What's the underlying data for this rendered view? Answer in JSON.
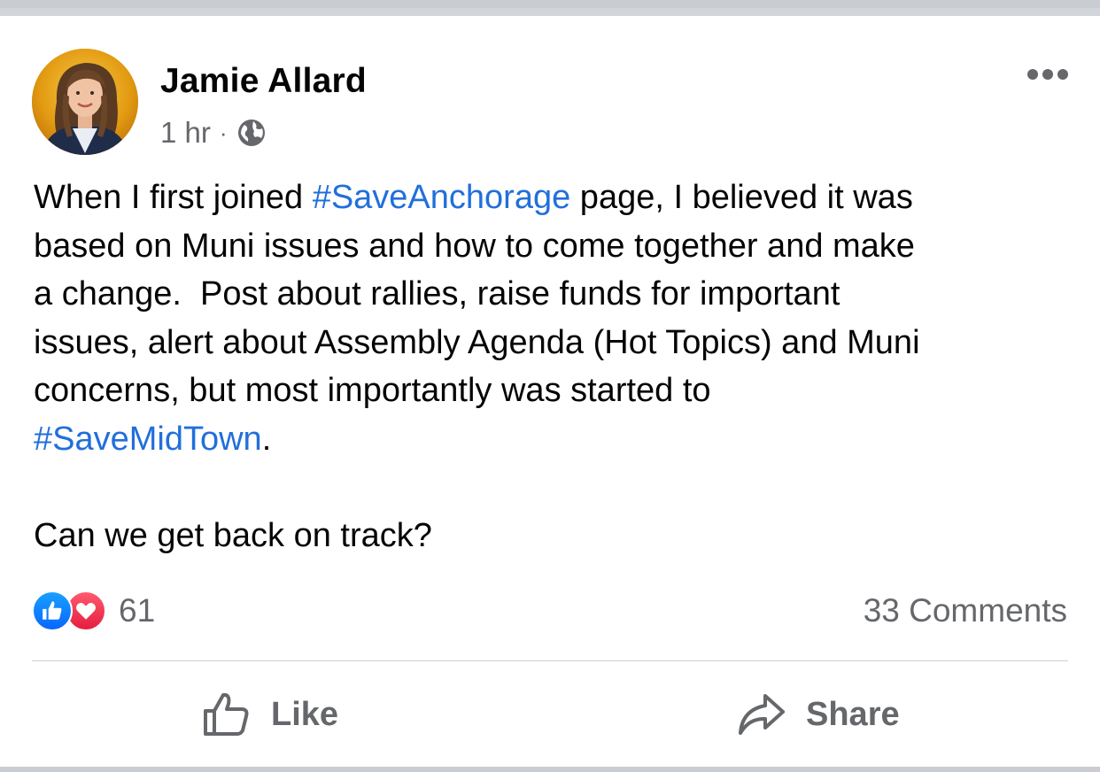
{
  "post": {
    "author": "Jamie Allard",
    "time": "1 hr",
    "separator": "·",
    "audience_icon": "globe-icon",
    "text_segments": [
      {
        "text": "When I first joined ",
        "hashtag": false
      },
      {
        "text": "#SaveAnchorage",
        "hashtag": true
      },
      {
        "text": " page, I believed it was\nbased on Muni issues and how to come together and make\na change.  Post about rallies, raise funds for important\nissues, alert about Assembly Agenda (Hot Topics) and Muni\nconcerns, but most importantly was started to\n",
        "hashtag": false
      },
      {
        "text": "#SaveMidTown",
        "hashtag": true
      },
      {
        "text": ".\n\nCan we get back on track?",
        "hashtag": false
      }
    ]
  },
  "reactions": {
    "count": "61",
    "icons": [
      "like-reaction-icon",
      "love-reaction-icon"
    ]
  },
  "comments_label": "33 Comments",
  "actions": {
    "like_label": "Like",
    "share_label": "Share"
  },
  "colors": {
    "hashtag": "#216fdb",
    "secondary_text": "#65676b",
    "like_blue": "#0866ff",
    "love_red": "#e41e3f"
  }
}
